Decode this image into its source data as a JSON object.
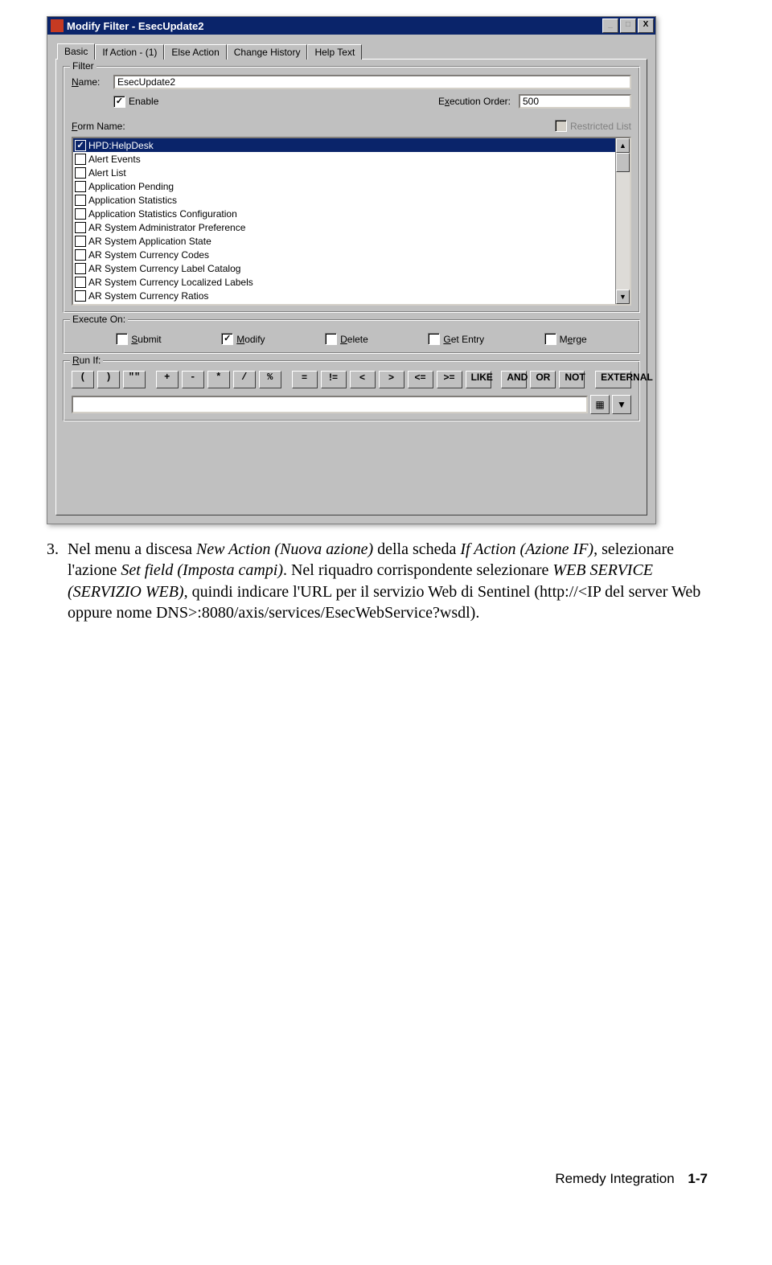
{
  "window": {
    "title": "Modify Filter - EsecUpdate2",
    "buttons": {
      "min": "_",
      "max": "□",
      "close": "X"
    }
  },
  "tabs": [
    "Basic",
    "If Action - (1)",
    "Else Action",
    "Change History",
    "Help Text"
  ],
  "activeTab": "Basic",
  "filter": {
    "legend": "Filter",
    "nameLabel": "Name:",
    "nameValue": "EsecUpdate2",
    "enableLabel": "Enable",
    "enableChecked": true,
    "execOrderLabel": "Execution Order:",
    "execOrderValue": "500",
    "formNameLabel": "Form Name:",
    "restrictedLabel": "Restricted List",
    "forms": [
      {
        "label": "HPD:HelpDesk",
        "checked": true,
        "selected": true
      },
      {
        "label": "Alert Events",
        "checked": false,
        "selected": false
      },
      {
        "label": "Alert List",
        "checked": false,
        "selected": false
      },
      {
        "label": "Application Pending",
        "checked": false,
        "selected": false
      },
      {
        "label": "Application Statistics",
        "checked": false,
        "selected": false
      },
      {
        "label": "Application Statistics Configuration",
        "checked": false,
        "selected": false
      },
      {
        "label": "AR System Administrator Preference",
        "checked": false,
        "selected": false
      },
      {
        "label": "AR System Application State",
        "checked": false,
        "selected": false
      },
      {
        "label": "AR System Currency Codes",
        "checked": false,
        "selected": false
      },
      {
        "label": "AR System Currency Label Catalog",
        "checked": false,
        "selected": false
      },
      {
        "label": "AR System Currency Localized Labels",
        "checked": false,
        "selected": false
      },
      {
        "label": "AR System Currency Ratios",
        "checked": false,
        "selected": false
      }
    ]
  },
  "executeOn": {
    "legend": "Execute On:",
    "items": [
      {
        "label": "Submit",
        "checked": false
      },
      {
        "label": "Modify",
        "checked": true
      },
      {
        "label": "Delete",
        "checked": false
      },
      {
        "label": "Get Entry",
        "checked": false
      },
      {
        "label": "Merge",
        "checked": false
      }
    ]
  },
  "runIf": {
    "legend": "Run If:",
    "ops1": [
      "(",
      ")",
      "\"\""
    ],
    "ops2": [
      "+",
      "-",
      "*",
      "/",
      "%"
    ],
    "ops3": [
      "=",
      "!=",
      "<",
      ">",
      "<=",
      ">=",
      "LIKE"
    ],
    "ops4": [
      "AND",
      "OR",
      "NOT"
    ],
    "ops5": [
      "EXTERNAL"
    ],
    "value": ""
  },
  "body": {
    "num": "3.",
    "text_a": "Nel menu a discesa ",
    "it_1": "New Action (Nuova azione)",
    "text_b": " della scheda ",
    "it_2": "If Action (Azione IF)",
    "text_c": ", selezionare l'azione ",
    "it_3": "Set field (Imposta campi)",
    "text_d": ". Nel riquadro corrispondente selezionare ",
    "it_4": "WEB SERVICE (SERVIZIO WEB)",
    "text_e": ", quindi indicare l'URL per il servizio Web di Sentinel (http://<IP del server Web oppure nome DNS>:8080/axis/services/EsecWebService?wsdl)."
  },
  "footer": {
    "label": "Remedy Integration",
    "page": "1-7"
  }
}
